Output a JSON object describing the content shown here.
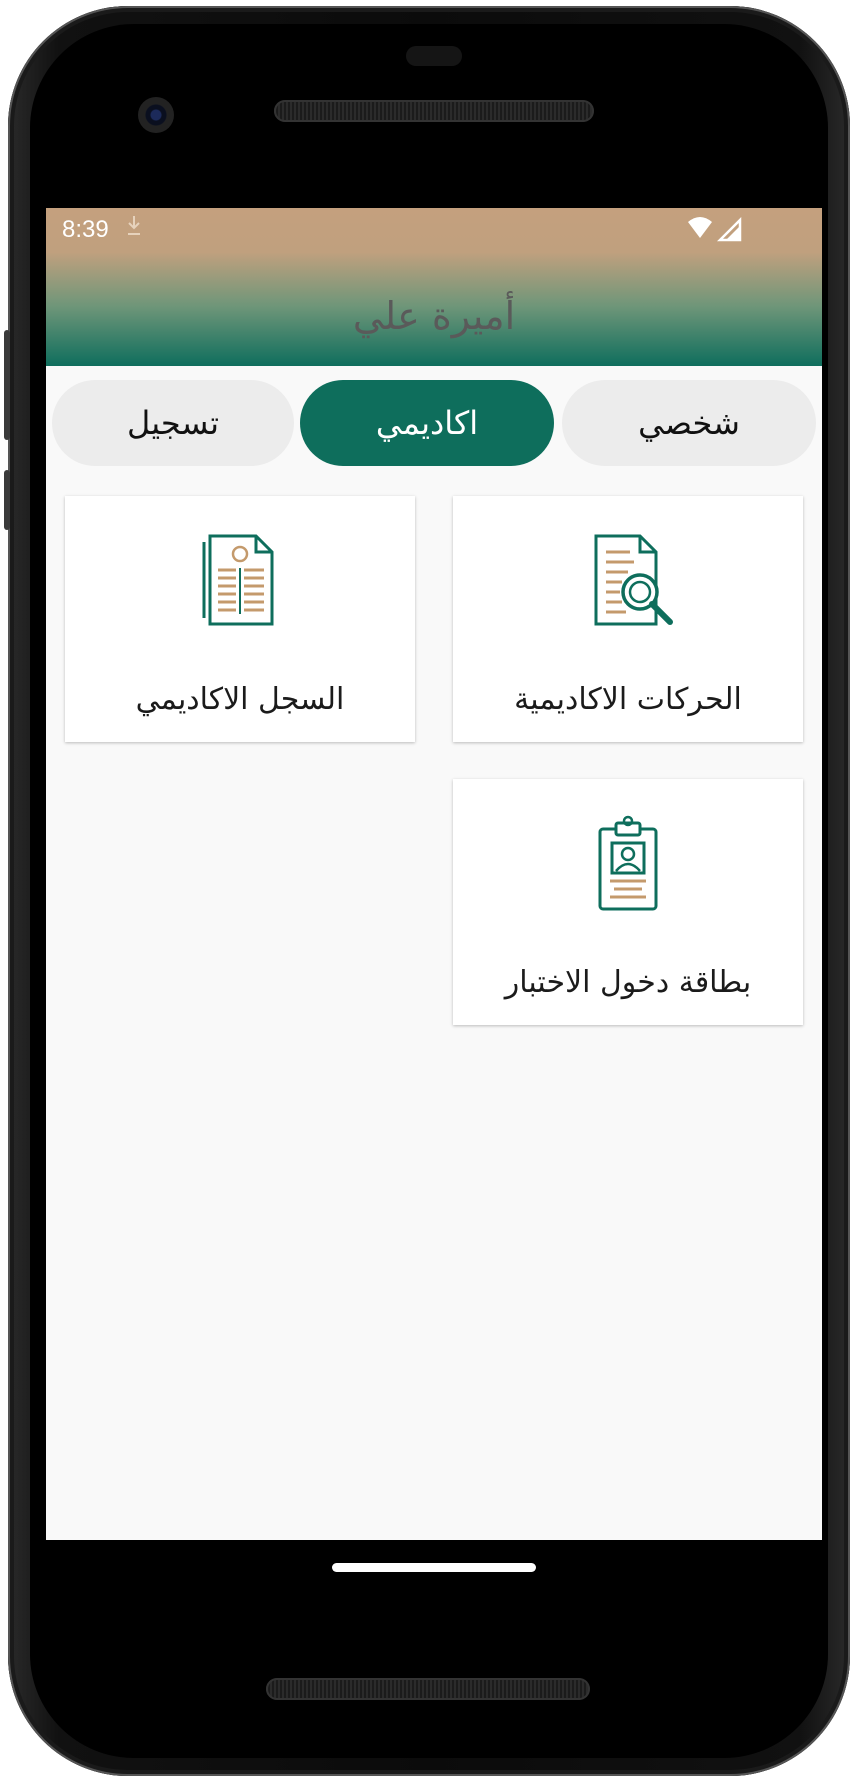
{
  "status_bar": {
    "time": "8:39"
  },
  "header": {
    "title": "أميرة علي"
  },
  "tabs": [
    {
      "label": "شخصي",
      "active": false
    },
    {
      "label": "اكاديمي",
      "active": true
    },
    {
      "label": "تسجيل",
      "active": false
    }
  ],
  "cards": [
    {
      "label": "الحركات الاكاديمية",
      "icon": "document-search-icon"
    },
    {
      "label": "السجل الاكاديمي",
      "icon": "academic-record-icon"
    },
    {
      "label": "بطاقة دخول الاختبار",
      "icon": "id-badge-icon"
    }
  ],
  "colors": {
    "primary": "#0e6e5c",
    "accent": "#c49a6c",
    "header_top": "#c4a07e"
  }
}
